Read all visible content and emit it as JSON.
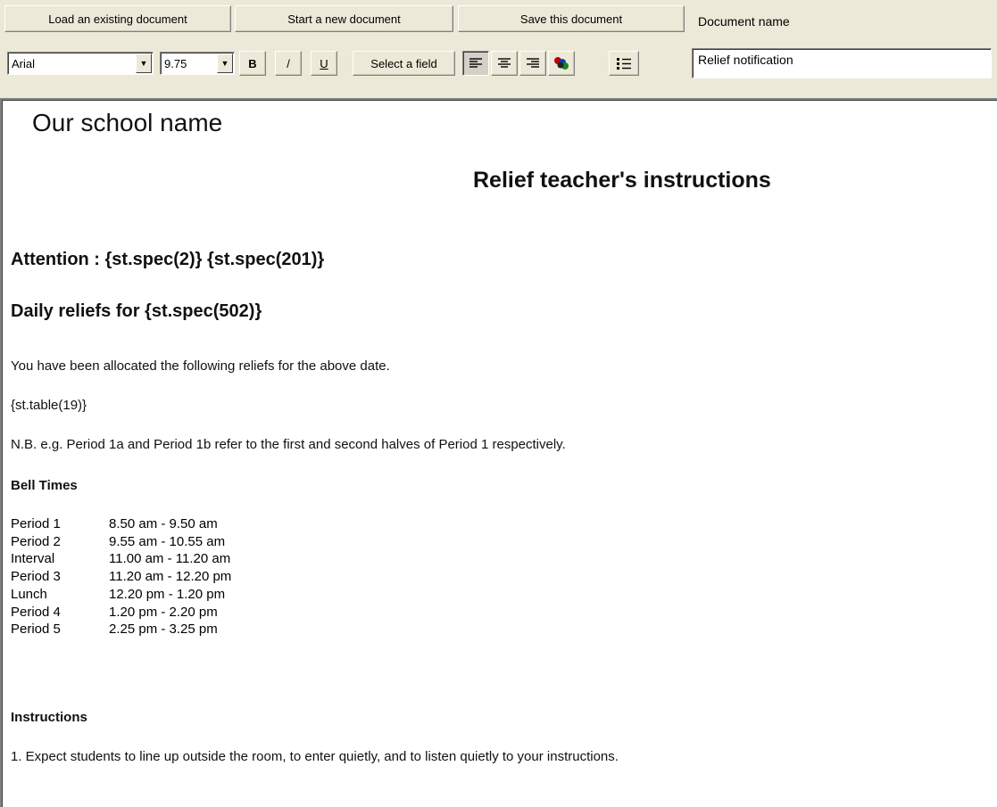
{
  "toolbar": {
    "load_label": "Load an existing document",
    "new_label": "Start a new document",
    "save_label": "Save this document",
    "docname_label": "Document name",
    "font_value": "Arial",
    "size_value": "9.75",
    "bold_label": "B",
    "italic_label": "/",
    "underline_label": "U",
    "select_field_label": "Select a field",
    "docname_value": "Relief notification",
    "icons": [
      "align-left-icon",
      "align-center-icon",
      "align-right-icon",
      "font-color-icon",
      "bullet-list-icon"
    ]
  },
  "document": {
    "school": "Our school name",
    "heading": "Relief teacher's instructions",
    "attention": "Attention : {st.spec(2)} {st.spec(201)}",
    "daily": "Daily reliefs for {st.spec(502)}",
    "allocated": "You have been allocated the following reliefs for the above date.",
    "table_field": "{st.table(19)}",
    "nb": "N.B. e.g. Period 1a and Period 1b refer to the first and second halves of Period 1 respectively.",
    "bell_heading": "Bell Times",
    "bell_times": [
      {
        "name": "Period 1",
        "time": "8.50 am - 9.50 am"
      },
      {
        "name": "Period 2",
        "time": "9.55 am - 10.55 am"
      },
      {
        "name": "Interval",
        "time": "11.00 am - 11.20 am"
      },
      {
        "name": "Period 3",
        "time": "11.20 am - 12.20 pm"
      },
      {
        "name": "Lunch",
        "time": "12.20 pm - 1.20 pm"
      },
      {
        "name": "Period 4",
        "time": "1.20 pm - 2.20 pm"
      },
      {
        "name": "Period 5",
        "time": "2.25 pm - 3.25 pm"
      }
    ],
    "instructions_heading": "Instructions",
    "instruction_1": "1.  Expect students to line up outside the room, to enter quietly, and to listen quietly to your instructions."
  }
}
